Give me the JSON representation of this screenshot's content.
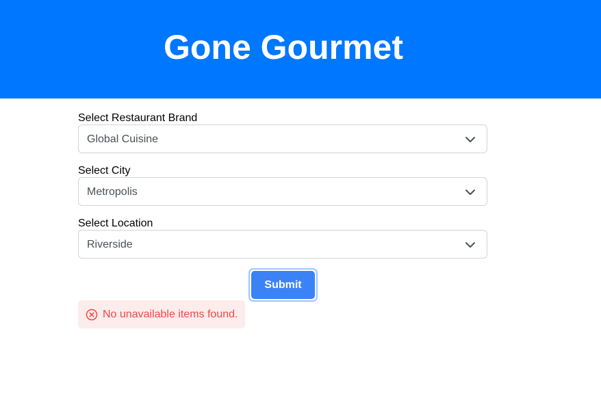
{
  "header": {
    "title": "Gone Gourmet",
    "background_color": "#0077ff"
  },
  "form": {
    "brand": {
      "label": "Select Restaurant Brand",
      "value": "Global Cuisine",
      "icon": "chevron-down-icon"
    },
    "city": {
      "label": "Select City",
      "value": "Metropolis",
      "icon": "chevron-down-icon"
    },
    "location": {
      "label": "Select Location",
      "value": "Riverside",
      "icon": "chevron-down-icon"
    },
    "submit_label": "Submit",
    "submit_color": "#3b82f6"
  },
  "alert": {
    "icon": "x-circle-icon",
    "message": "No unavailable items found.",
    "text_color": "#f04848",
    "background_color": "#fdecec"
  }
}
